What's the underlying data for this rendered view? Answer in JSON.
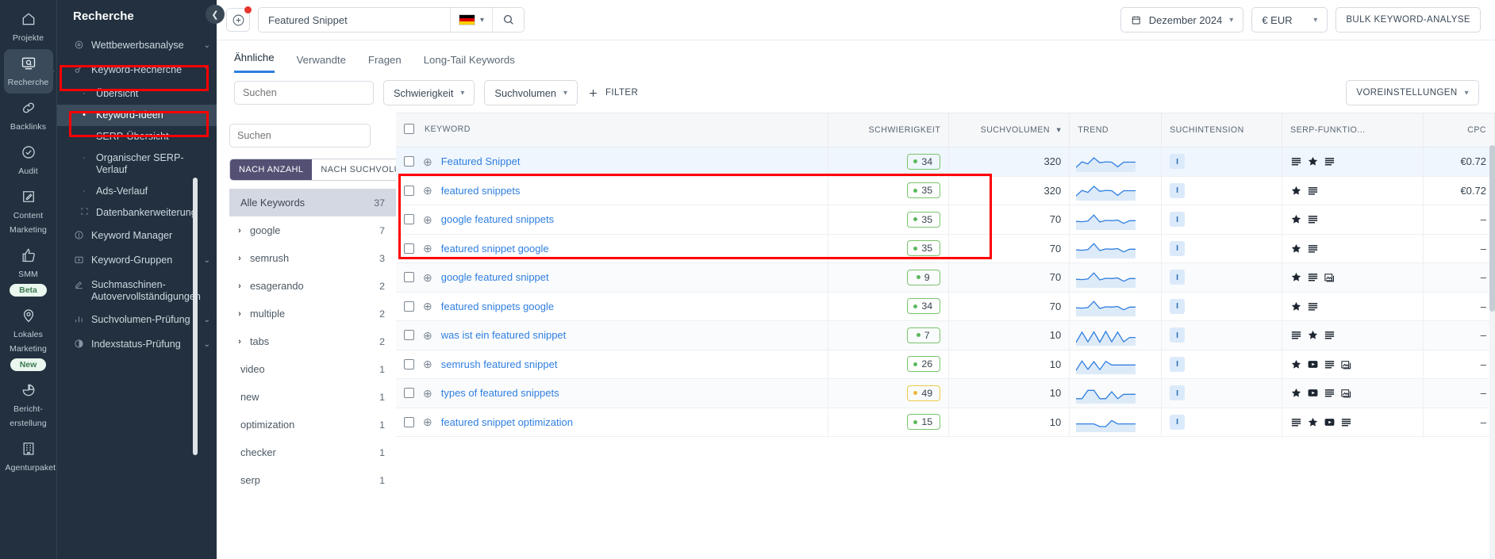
{
  "rail": {
    "items": [
      {
        "label": "Projekte",
        "icon": "home-icon",
        "active": false,
        "badge": null
      },
      {
        "label": "Recherche",
        "icon": "magnifier-screen-icon",
        "active": true,
        "badge": null
      },
      {
        "label": "Backlinks",
        "icon": "link-icon",
        "active": false,
        "badge": null
      },
      {
        "label": "Audit",
        "icon": "check-circle-icon",
        "active": false,
        "badge": null
      },
      {
        "label": "Content Marketing",
        "icon": "pencil-square-icon",
        "active": false,
        "badge": null
      },
      {
        "label": "SMM",
        "icon": "thumbs-up-icon",
        "active": false,
        "badge": "Beta"
      },
      {
        "label": "Lokales Marketing",
        "icon": "map-pin-icon",
        "active": false,
        "badge": "New"
      },
      {
        "label": "Bericht-erstellung",
        "icon": "pie-chart-icon",
        "active": false,
        "badge": null
      },
      {
        "label": "Agenturpaket",
        "icon": "building-icon",
        "active": false,
        "badge": null
      }
    ]
  },
  "sidebar": {
    "title": "Recherche",
    "items": [
      {
        "label": "Wettbewerbsanalyse",
        "icon": "target-icon",
        "type": "group",
        "chevron": "⌄",
        "current": false
      },
      {
        "label": "Keyword-Recherche",
        "icon": "key-icon",
        "type": "group",
        "chevron": "⌃",
        "current": false
      },
      {
        "label": "Übersicht",
        "type": "sub",
        "current": false
      },
      {
        "label": "Keyword-Ideen",
        "type": "sub",
        "current": true
      },
      {
        "label": "SERP-Übersicht",
        "type": "sub",
        "current": false
      },
      {
        "label": "Organischer SERP-Verlauf",
        "type": "sub",
        "current": false
      },
      {
        "label": "Ads-Verlauf",
        "type": "sub",
        "current": false
      },
      {
        "label": "Datenbankerweiterung",
        "type": "sub-icon",
        "icon": "expand-icon",
        "current": false
      },
      {
        "label": "Keyword Manager",
        "icon": "info-circle-icon",
        "type": "group",
        "chevron": "",
        "current": false
      },
      {
        "label": "Keyword-Gruppen",
        "icon": "folder-plus-icon",
        "type": "group",
        "chevron": "⌄",
        "current": false
      },
      {
        "label": "Suchmaschinen-Autovervollständigungen",
        "icon": "pen-underline-icon",
        "type": "group",
        "chevron": "",
        "current": false
      },
      {
        "label": "Suchvolumen-Prüfung",
        "icon": "bar-chart-icon",
        "type": "group",
        "chevron": "⌄",
        "current": false
      },
      {
        "label": "Indexstatus-Prüfung",
        "icon": "half-circle-icon",
        "type": "group",
        "chevron": "⌄",
        "current": false
      }
    ]
  },
  "topbar": {
    "add_button_icon": "plus-circle-icon",
    "search_value": "Featured Snippet",
    "search_placeholder": "Featured Snippet",
    "locale_flag": "de-flag-icon",
    "search_icon": "search-icon",
    "date_range": "Dezember 2024",
    "date_icon": "calendar-icon",
    "currency": "€ EUR",
    "bulk_button": "BULK KEYWORD-ANALYSE"
  },
  "tabs": [
    {
      "label": "Ähnliche",
      "active": true
    },
    {
      "label": "Verwandte",
      "active": false
    },
    {
      "label": "Fragen",
      "active": false
    },
    {
      "label": "Long-Tail Keywords",
      "active": false
    }
  ],
  "filters": {
    "search_placeholder": "Suchen",
    "search_icon": "search-icon",
    "difficulty_label": "Schwierigkeit",
    "volume_label": "Suchvolumen",
    "filter_label": "FILTER",
    "filter_icon": "plus-icon",
    "presets_label": "VOREINSTELLUNGEN"
  },
  "groups": {
    "search_placeholder": "Suchen",
    "segments": [
      {
        "label": "NACH ANZAHL",
        "active": true
      },
      {
        "label": "NACH SUCHVOLUMEN",
        "active": false
      }
    ],
    "all_label": "Alle Keywords",
    "all_count": "37",
    "items": [
      {
        "label": "google",
        "count": "7",
        "expandable": true
      },
      {
        "label": "semrush",
        "count": "3",
        "expandable": true
      },
      {
        "label": "esagerando",
        "count": "2",
        "expandable": true
      },
      {
        "label": "multiple",
        "count": "2",
        "expandable": true
      },
      {
        "label": "tabs",
        "count": "2",
        "expandable": true
      },
      {
        "label": "video",
        "count": "1",
        "expandable": false
      },
      {
        "label": "new",
        "count": "1",
        "expandable": false
      },
      {
        "label": "optimization",
        "count": "1",
        "expandable": false
      },
      {
        "label": "checker",
        "count": "1",
        "expandable": false
      },
      {
        "label": "serp",
        "count": "1",
        "expandable": false
      }
    ]
  },
  "table": {
    "columns": [
      {
        "key": "keyword",
        "label": "KEYWORD",
        "align": "left"
      },
      {
        "key": "difficulty",
        "label": "SCHWIERIGKEIT",
        "align": "right"
      },
      {
        "key": "volume",
        "label": "SUCHVOLUMEN",
        "align": "right",
        "sorted": true,
        "sort_icon": "chevron-down-icon"
      },
      {
        "key": "trend",
        "label": "TREND",
        "align": "left"
      },
      {
        "key": "intent",
        "label": "SUCHINTENSION",
        "align": "left"
      },
      {
        "key": "serp",
        "label": "SERP-FUNKTIO...",
        "align": "left"
      },
      {
        "key": "cpc",
        "label": "CPC",
        "align": "right"
      }
    ],
    "rows": [
      {
        "keyword": "Featured Snippet",
        "difficulty": "34",
        "diff_color": "g",
        "volume": "320",
        "intent": "I",
        "serp": [
          "lines-icon",
          "star-icon",
          "lines-icon"
        ],
        "cpc": "€0.72",
        "trend": [
          18,
          52,
          40,
          76,
          46,
          52,
          50,
          22,
          50,
          50,
          50
        ],
        "highlighted": true,
        "selected": true
      },
      {
        "keyword": "featured snippets",
        "difficulty": "35",
        "diff_color": "g",
        "volume": "320",
        "intent": "I",
        "serp": [
          "star-icon",
          "lines-icon"
        ],
        "cpc": "€0.72",
        "trend": [
          18,
          52,
          40,
          76,
          46,
          52,
          50,
          22,
          50,
          50,
          50
        ],
        "highlighted": true,
        "selected": false
      },
      {
        "keyword": "google featured snippets",
        "difficulty": "35",
        "diff_color": "g",
        "volume": "70",
        "intent": "I",
        "serp": [
          "star-icon",
          "lines-icon"
        ],
        "cpc": "–",
        "trend": [
          42,
          40,
          44,
          80,
          38,
          48,
          46,
          50,
          30,
          46,
          46
        ],
        "highlighted": true,
        "selected": false
      },
      {
        "keyword": "featured snippet google",
        "difficulty": "35",
        "diff_color": "g",
        "volume": "70",
        "intent": "I",
        "serp": [
          "star-icon",
          "lines-icon"
        ],
        "cpc": "–",
        "trend": [
          42,
          40,
          44,
          80,
          38,
          48,
          46,
          50,
          30,
          46,
          46
        ],
        "highlighted": false,
        "selected": false
      },
      {
        "keyword": "google featured snippet",
        "difficulty": "9",
        "diff_color": "g",
        "volume": "70",
        "intent": "I",
        "serp": [
          "star-icon",
          "lines-icon",
          "image-icon"
        ],
        "cpc": "–",
        "trend": [
          42,
          40,
          44,
          80,
          38,
          48,
          46,
          50,
          30,
          46,
          46
        ],
        "highlighted": false,
        "selected": false
      },
      {
        "keyword": "featured snippets google",
        "difficulty": "34",
        "diff_color": "g",
        "volume": "70",
        "intent": "I",
        "serp": [
          "star-icon",
          "lines-icon"
        ],
        "cpc": "–",
        "trend": [
          42,
          40,
          44,
          80,
          38,
          48,
          46,
          50,
          30,
          46,
          46
        ],
        "highlighted": false,
        "selected": false
      },
      {
        "keyword": "was ist ein featured snippet",
        "difficulty": "7",
        "diff_color": "g",
        "volume": "10",
        "intent": "I",
        "serp": [
          "lines-icon",
          "star-icon",
          "lines-icon"
        ],
        "cpc": "–",
        "trend": [
          10,
          72,
          14,
          74,
          12,
          76,
          14,
          72,
          14,
          40,
          40
        ],
        "highlighted": false,
        "selected": false
      },
      {
        "keyword": "semrush featured snippet",
        "difficulty": "26",
        "diff_color": "g",
        "volume": "10",
        "intent": "I",
        "serp": [
          "star-icon",
          "video-icon",
          "lines-icon",
          "image-icon"
        ],
        "cpc": "–",
        "trend": [
          14,
          70,
          20,
          66,
          18,
          68,
          46,
          46,
          46,
          46,
          46
        ],
        "highlighted": false,
        "selected": false
      },
      {
        "keyword": "types of featured snippets",
        "difficulty": "49",
        "diff_color": "y",
        "volume": "10",
        "intent": "I",
        "serp": [
          "star-icon",
          "video-icon",
          "lines-icon",
          "image-icon"
        ],
        "cpc": "–",
        "trend": [
          20,
          20,
          70,
          70,
          20,
          20,
          62,
          20,
          46,
          46,
          46
        ],
        "highlighted": false,
        "selected": false
      },
      {
        "keyword": "featured snippet optimization",
        "difficulty": "15",
        "diff_color": "g",
        "volume": "10",
        "intent": "I",
        "serp": [
          "lines-icon",
          "star-icon",
          "video-icon",
          "lines-icon"
        ],
        "cpc": "–",
        "trend": [
          40,
          40,
          40,
          40,
          24,
          24,
          60,
          40,
          40,
          40,
          40
        ],
        "highlighted": false,
        "selected": false
      }
    ]
  },
  "annotations": {
    "color": "#ff0000",
    "boxes": [
      "keyword-recherche-nav",
      "keyword-ideen-nav",
      "top-three-rows"
    ]
  }
}
